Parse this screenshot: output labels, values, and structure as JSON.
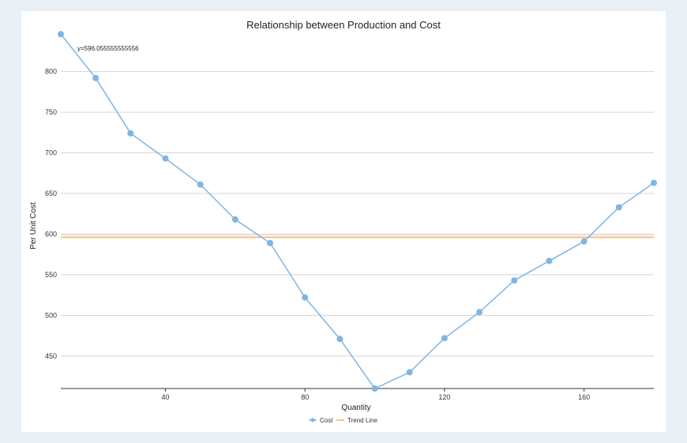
{
  "chart_data": {
    "type": "line",
    "title": "Relationship between Production and Cost",
    "xlabel": "Quantity",
    "ylabel": "Per Unit Cost",
    "xlim": [
      10,
      180
    ],
    "ylim": [
      410,
      855
    ],
    "xticks": [
      40,
      80,
      120,
      160
    ],
    "yticks": [
      450,
      500,
      550,
      600,
      650,
      700,
      750,
      800
    ],
    "grid": "horizontal",
    "legend_position": "bottom-center",
    "series": [
      {
        "name": "Cost",
        "color": "#7fb5e3",
        "marker": "circle",
        "x": [
          10,
          20,
          30,
          40,
          50,
          60,
          70,
          80,
          90,
          100,
          110,
          120,
          130,
          140,
          150,
          160,
          170,
          180
        ],
        "y": [
          846,
          792,
          724,
          693,
          661,
          618,
          589,
          522,
          471,
          410,
          430,
          472,
          504,
          543,
          567,
          591,
          633,
          663
        ]
      },
      {
        "name": "Trend Line",
        "color": "#f2b066",
        "x": [
          10,
          180
        ],
        "y": [
          596.0555555555557,
          596.0555555555557
        ]
      }
    ],
    "annotation": "y=596.055555555556"
  }
}
